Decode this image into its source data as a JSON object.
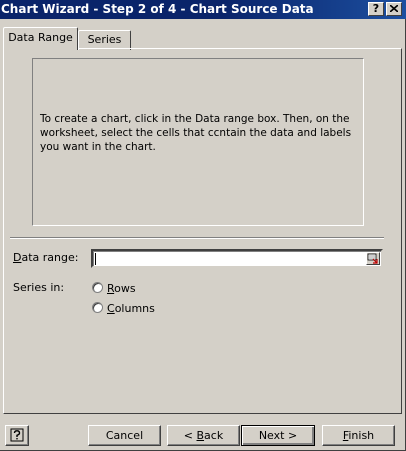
{
  "window": {
    "title": "Chart Wizard - Step 2 of 4 - Chart Source Data",
    "help_button": "?",
    "close_button": "✕"
  },
  "tabs": [
    {
      "label": "Data Range",
      "active": true
    },
    {
      "label": "Series",
      "active": false
    }
  ],
  "preview": {
    "message": "To create a chart, click in the Data range box. Then, on the worksheet, select the cells that ccntain the data and labels you want in the chart."
  },
  "data_range": {
    "label_pre": "",
    "label_mnemonic": "D",
    "label_post": "ata range:",
    "value": ""
  },
  "series_in": {
    "label": "Series in:",
    "options": [
      {
        "mnemonic": "R",
        "rest": "ows",
        "selected": false
      },
      {
        "mnemonic": "C",
        "rest": "olumns",
        "selected": false
      }
    ]
  },
  "buttons": {
    "help_icon": "help-icon",
    "cancel": "Cancel",
    "back_pre": "< ",
    "back_mnemonic": "B",
    "back_post": "ack",
    "next": "Next >",
    "finish_mnemonic": "F",
    "finish_post": "inish"
  },
  "colors": {
    "title_bar": "#0a246a",
    "face": "#d4d0c8"
  }
}
